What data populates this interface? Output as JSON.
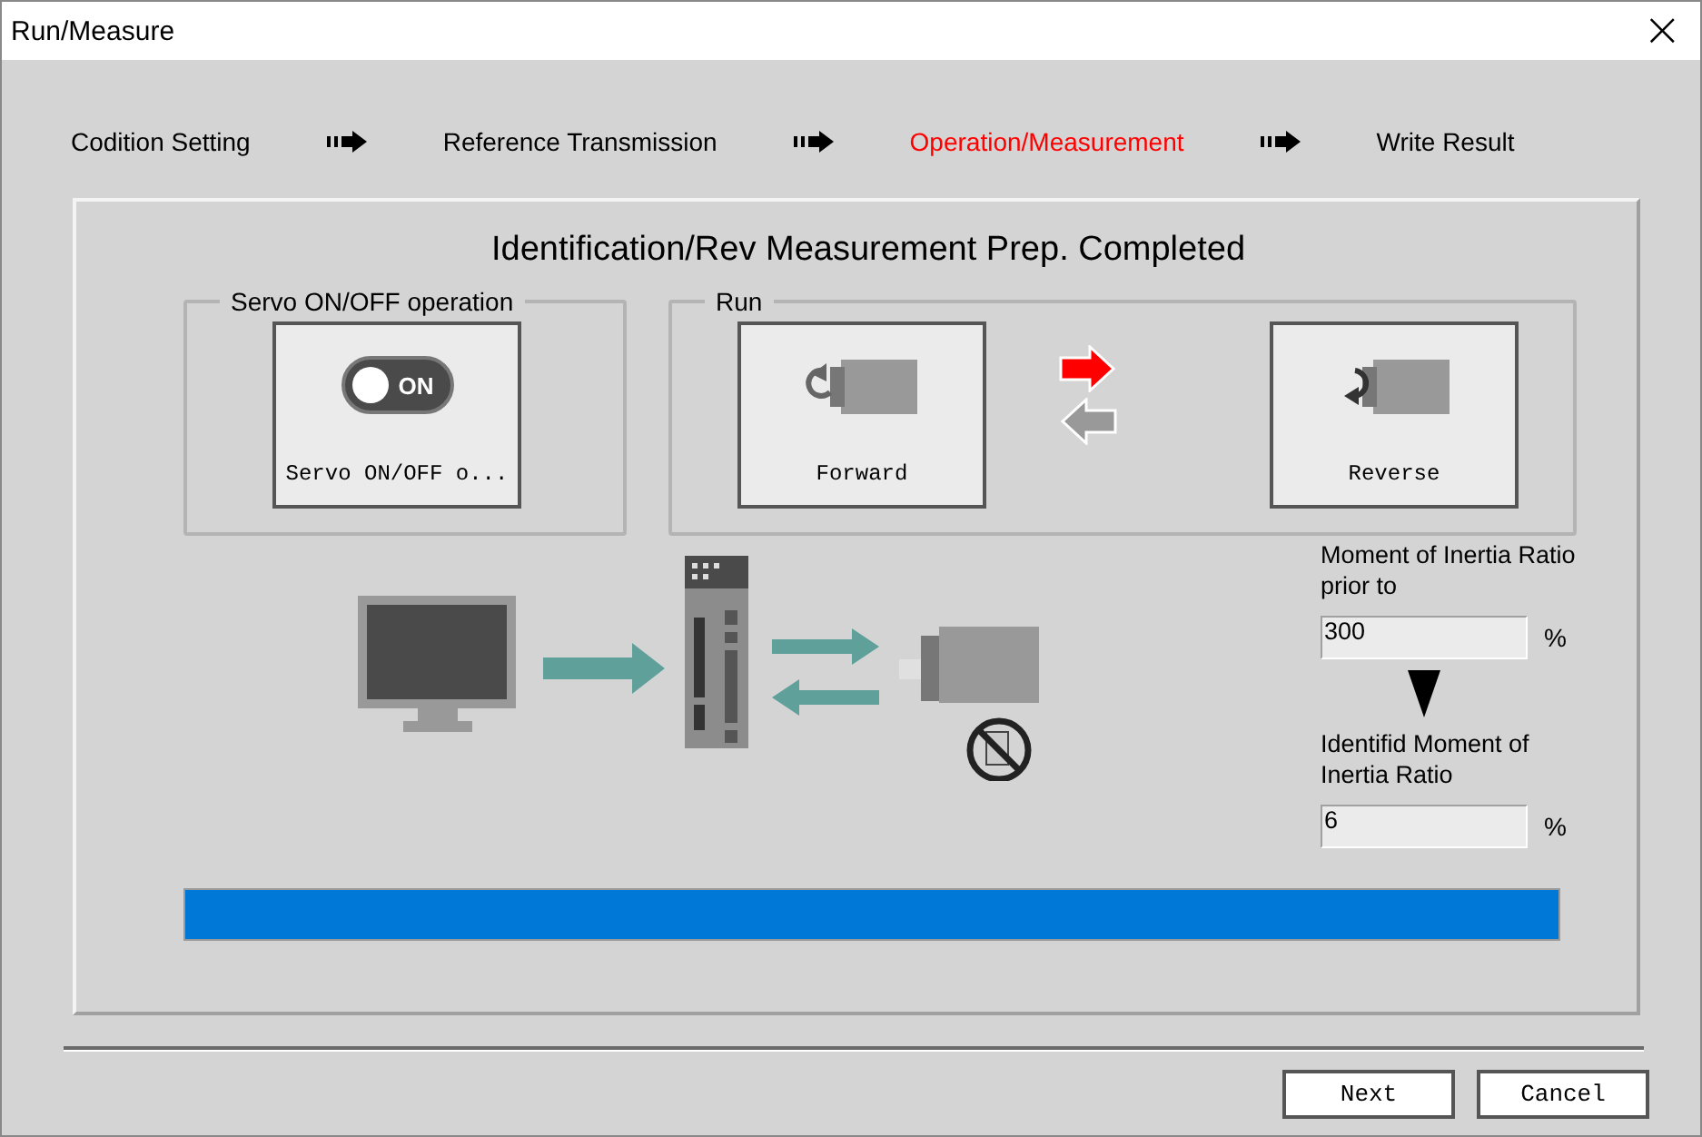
{
  "window": {
    "title": "Run/Measure",
    "close": "×"
  },
  "steps": [
    {
      "label": "Codition Setting",
      "selected": false
    },
    {
      "label": "Reference Transmission",
      "selected": false
    },
    {
      "label": "Operation/Measurement",
      "selected": true
    },
    {
      "label": "Write Result",
      "selected": false
    }
  ],
  "heading": "Identification/Rev Measurement Prep. Completed",
  "servo_group": {
    "label": "Servo ON/OFF operation",
    "button": {
      "label": "Servo ON/OFF o...",
      "switch_text": "ON",
      "on": true
    }
  },
  "run_group": {
    "label": "Run",
    "buttons": [
      {
        "label": "Forward",
        "selected": true
      },
      {
        "label": "Reverse",
        "selected": false
      }
    ]
  },
  "inertia_prior": {
    "label": "Moment of Inertia Ratio prior to",
    "value": "300",
    "unit": "%"
  },
  "inertia_identified": {
    "label": "Identifid Moment of Inertia Ratio",
    "value": "6",
    "unit": "%"
  },
  "progress": {
    "level": 1
  },
  "buttons": [
    {
      "label": "Next"
    },
    {
      "label": "Cancel"
    }
  ]
}
